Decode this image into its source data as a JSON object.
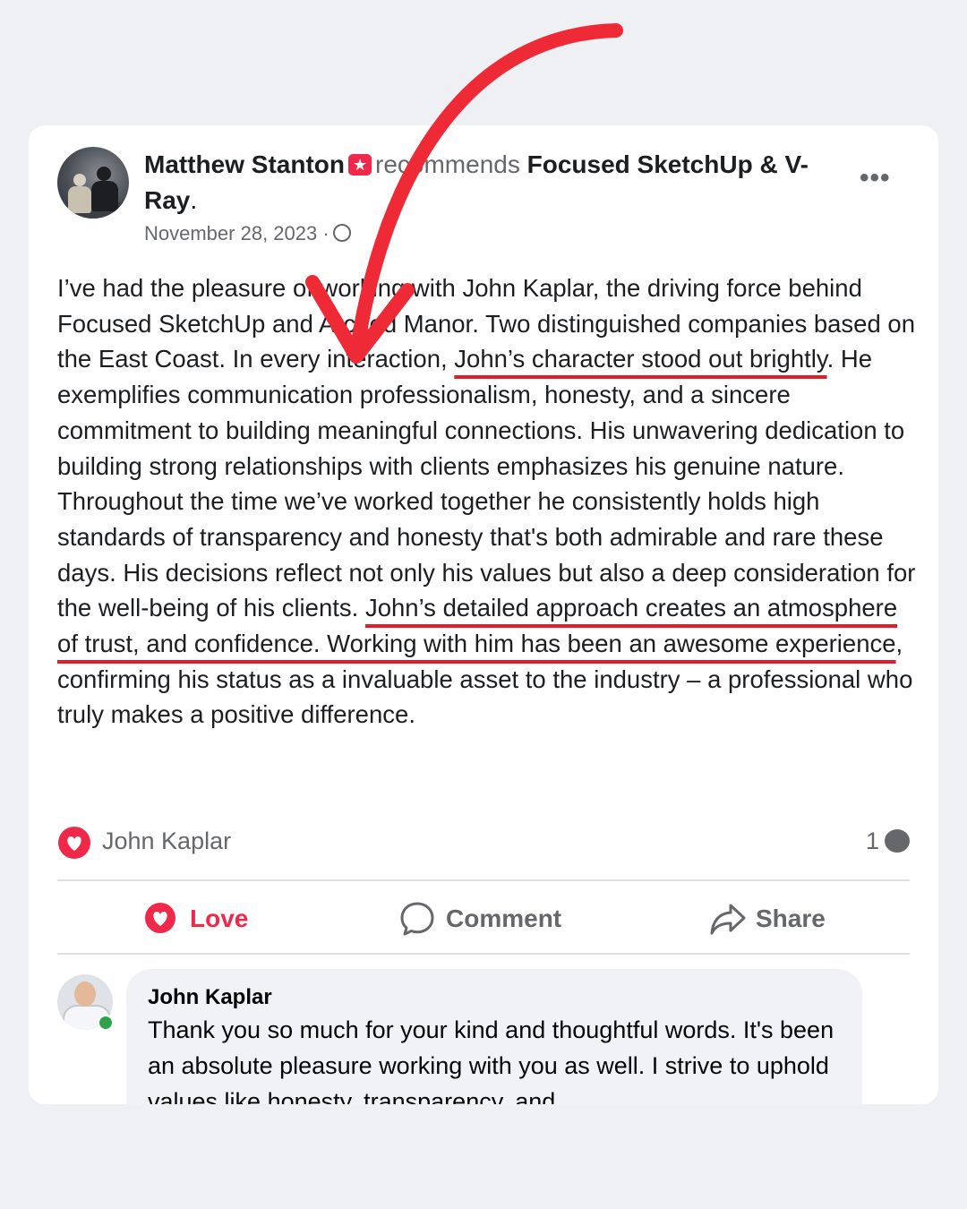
{
  "colors": {
    "page_bg": "#eef0f4",
    "card_bg": "#ffffff",
    "underline": "#e11d2a",
    "arrow": "#ee2a36",
    "love": "#f0284a",
    "muted": "#65676b",
    "online": "#31a24c"
  },
  "post": {
    "author": "Matthew Stanton",
    "badge_icon": "recommend-star-icon",
    "verb": "recommends",
    "page_name": "Focused SketchUp & V-Ray",
    "page_name_suffix": ".",
    "date": "November 28, 2023 ·",
    "more_label": "•••",
    "body": {
      "p1_a": "I’ve had the pleasure of working with John Kaplar, the driving force behind Focused SketchUp and Arched Manor. Two distinguished companies based on the East Coast. In every interaction, ",
      "p1_hl": "John’s character stood out brightly",
      "p1_b": ". He exemplifies communication professionalism, honesty, and a sincere commitment to building meaningful connections. His unwavering dedication to building strong relationships with clients emphasizes his genuine nature.",
      "p2_a": "Throughout the time we’ve worked together he consistently holds high standards of transparency and honesty that's both admirable and rare these days. His decisions reflect not only his values but also a deep consideration for the well-being of his clients. ",
      "p2_hl": "John’s detailed approach creates an atmosphere of trust, and confidence. Working with him has been an awesome experience",
      "p2_b": ", confirming his status as a invaluable asset to the industry – a professional who truly makes a positive difference."
    }
  },
  "reactions": {
    "icon": "love-heart-icon",
    "reactor": "John Kaplar",
    "comment_count": "1",
    "comment_count_icon": "comment-bubble-icon"
  },
  "actions": {
    "love": "Love",
    "comment": "Comment",
    "share": "Share"
  },
  "comment": {
    "author": "John Kaplar",
    "text": "Thank you so much for your kind and thoughtful words. It's been an absolute pleasure working with you as well. I strive to uphold values like honesty, transparency, and"
  },
  "overlay": {
    "arrow_icon": "red-curved-arrow-icon"
  }
}
